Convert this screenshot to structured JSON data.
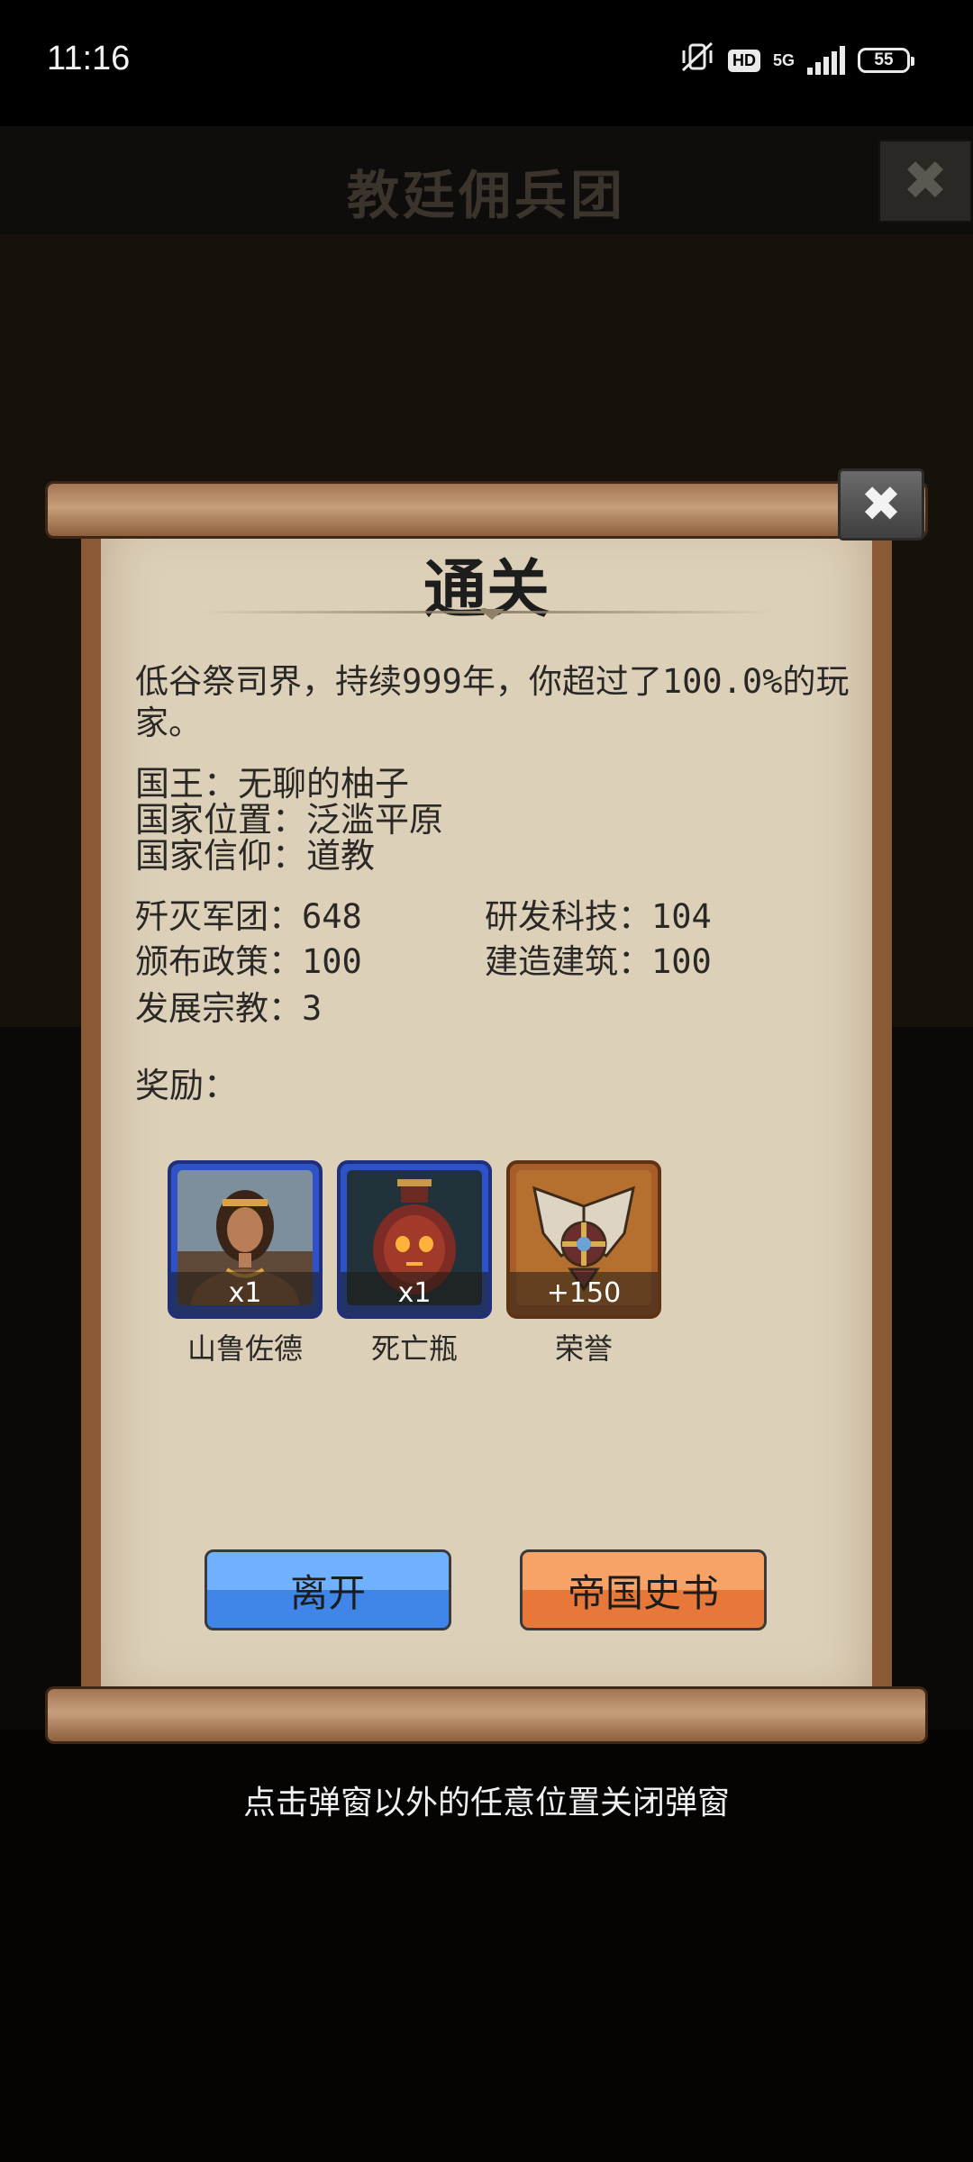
{
  "status_bar": {
    "time": "11:16",
    "hd_label": "HD",
    "network_label": "5G",
    "battery_level": "55"
  },
  "background": {
    "title": "教廷佣兵团",
    "close_glyph": "✖"
  },
  "popup": {
    "title": "通关",
    "close_glyph": "✖",
    "summary": "低谷祭司界，持续999年，你超过了100.0%的玩家。",
    "king": "国王：无聊的柚子",
    "location": "国家位置：泛滥平原",
    "religion": "国家信仰：道教",
    "stats": {
      "armies_destroyed": "歼灭军团：648",
      "tech_researched": "研发科技：104",
      "policies_issued": "颁布政策：100",
      "buildings_built": "建造建筑：100",
      "religions_developed": "发展宗教：3"
    },
    "rewards_label": "奖励：",
    "rewards": [
      {
        "name": "山鲁佐德",
        "count": "x1",
        "icon": "portrait-woman-icon"
      },
      {
        "name": "死亡瓶",
        "count": "x1",
        "icon": "death-vase-icon"
      },
      {
        "name": "荣誉",
        "count": "+150",
        "icon": "honor-emblem-icon"
      }
    ],
    "buttons": {
      "leave": "离开",
      "history": "帝国史书"
    }
  },
  "hint": "点击弹窗以外的任意位置关闭弹窗",
  "colors": {
    "paper": "#ddd0b9",
    "scroll_wood": "#8a5a36",
    "leave_button": "#4d94f0",
    "history_button": "#ec8a4c",
    "reward_blue": "#2e52c7",
    "reward_orange": "#a85e2b"
  }
}
